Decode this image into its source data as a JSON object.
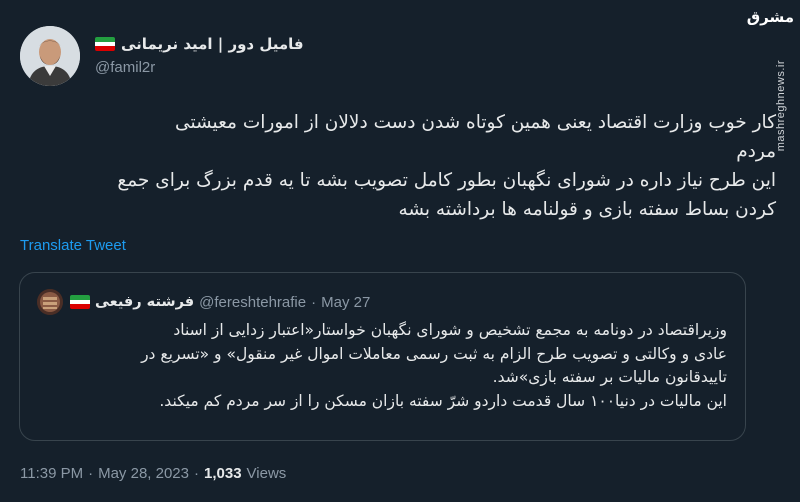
{
  "author": {
    "display_name": "فامیل دور | امید نریمانی",
    "handle": "@famil2r",
    "flag_icon": "iran-flag-icon"
  },
  "tweet": {
    "lines": [
      "کار خوب وزارت اقتصاد یعنی همین کوتاه شدن دست دلالان از امورات معیشتی",
      "مردم",
      "این طرح نیاز داره در شورای نگهبان بطور کامل تصویب بشه تا یه قدم بزرگ برای جمع",
      "کردن بساط سفته بازی و قولنامه ها برداشته بشه"
    ],
    "translate_label": "Translate Tweet"
  },
  "quote": {
    "display_name": "فرشته رفیعی",
    "handle": "@fereshtehrafie",
    "separator": "·",
    "date": "May 27",
    "lines": [
      "وزیراقتصاد در دونامه به مجمع تشخیص و شورای نگهبان خواستار«اعتبار زدایی از اسناد",
      "عادی و وکالتی و تصویب طرح الزام به ثبت رسمی معاملات اموال غیر منقول» و «تسریع در",
      "تاییدقانون مالیات بر سفته بازی»شد.",
      "این مالیات در دنیا۱۰۰ سال قدمت دارد‌و شرّ سفته بازان مسکن را از سر مردم کم میکند."
    ]
  },
  "meta": {
    "time": "11:39 PM",
    "separator": "·",
    "date": "May 28, 2023",
    "views_count": "1,033",
    "views_label": "Views"
  },
  "watermark": {
    "logo_line1": "مشرق",
    "site": "mashreghnews.ir"
  },
  "colors": {
    "background": "#15202b",
    "text": "#e7e9ea",
    "muted": "#8b98a5",
    "link": "#1d9bf0",
    "border": "#38444d"
  }
}
